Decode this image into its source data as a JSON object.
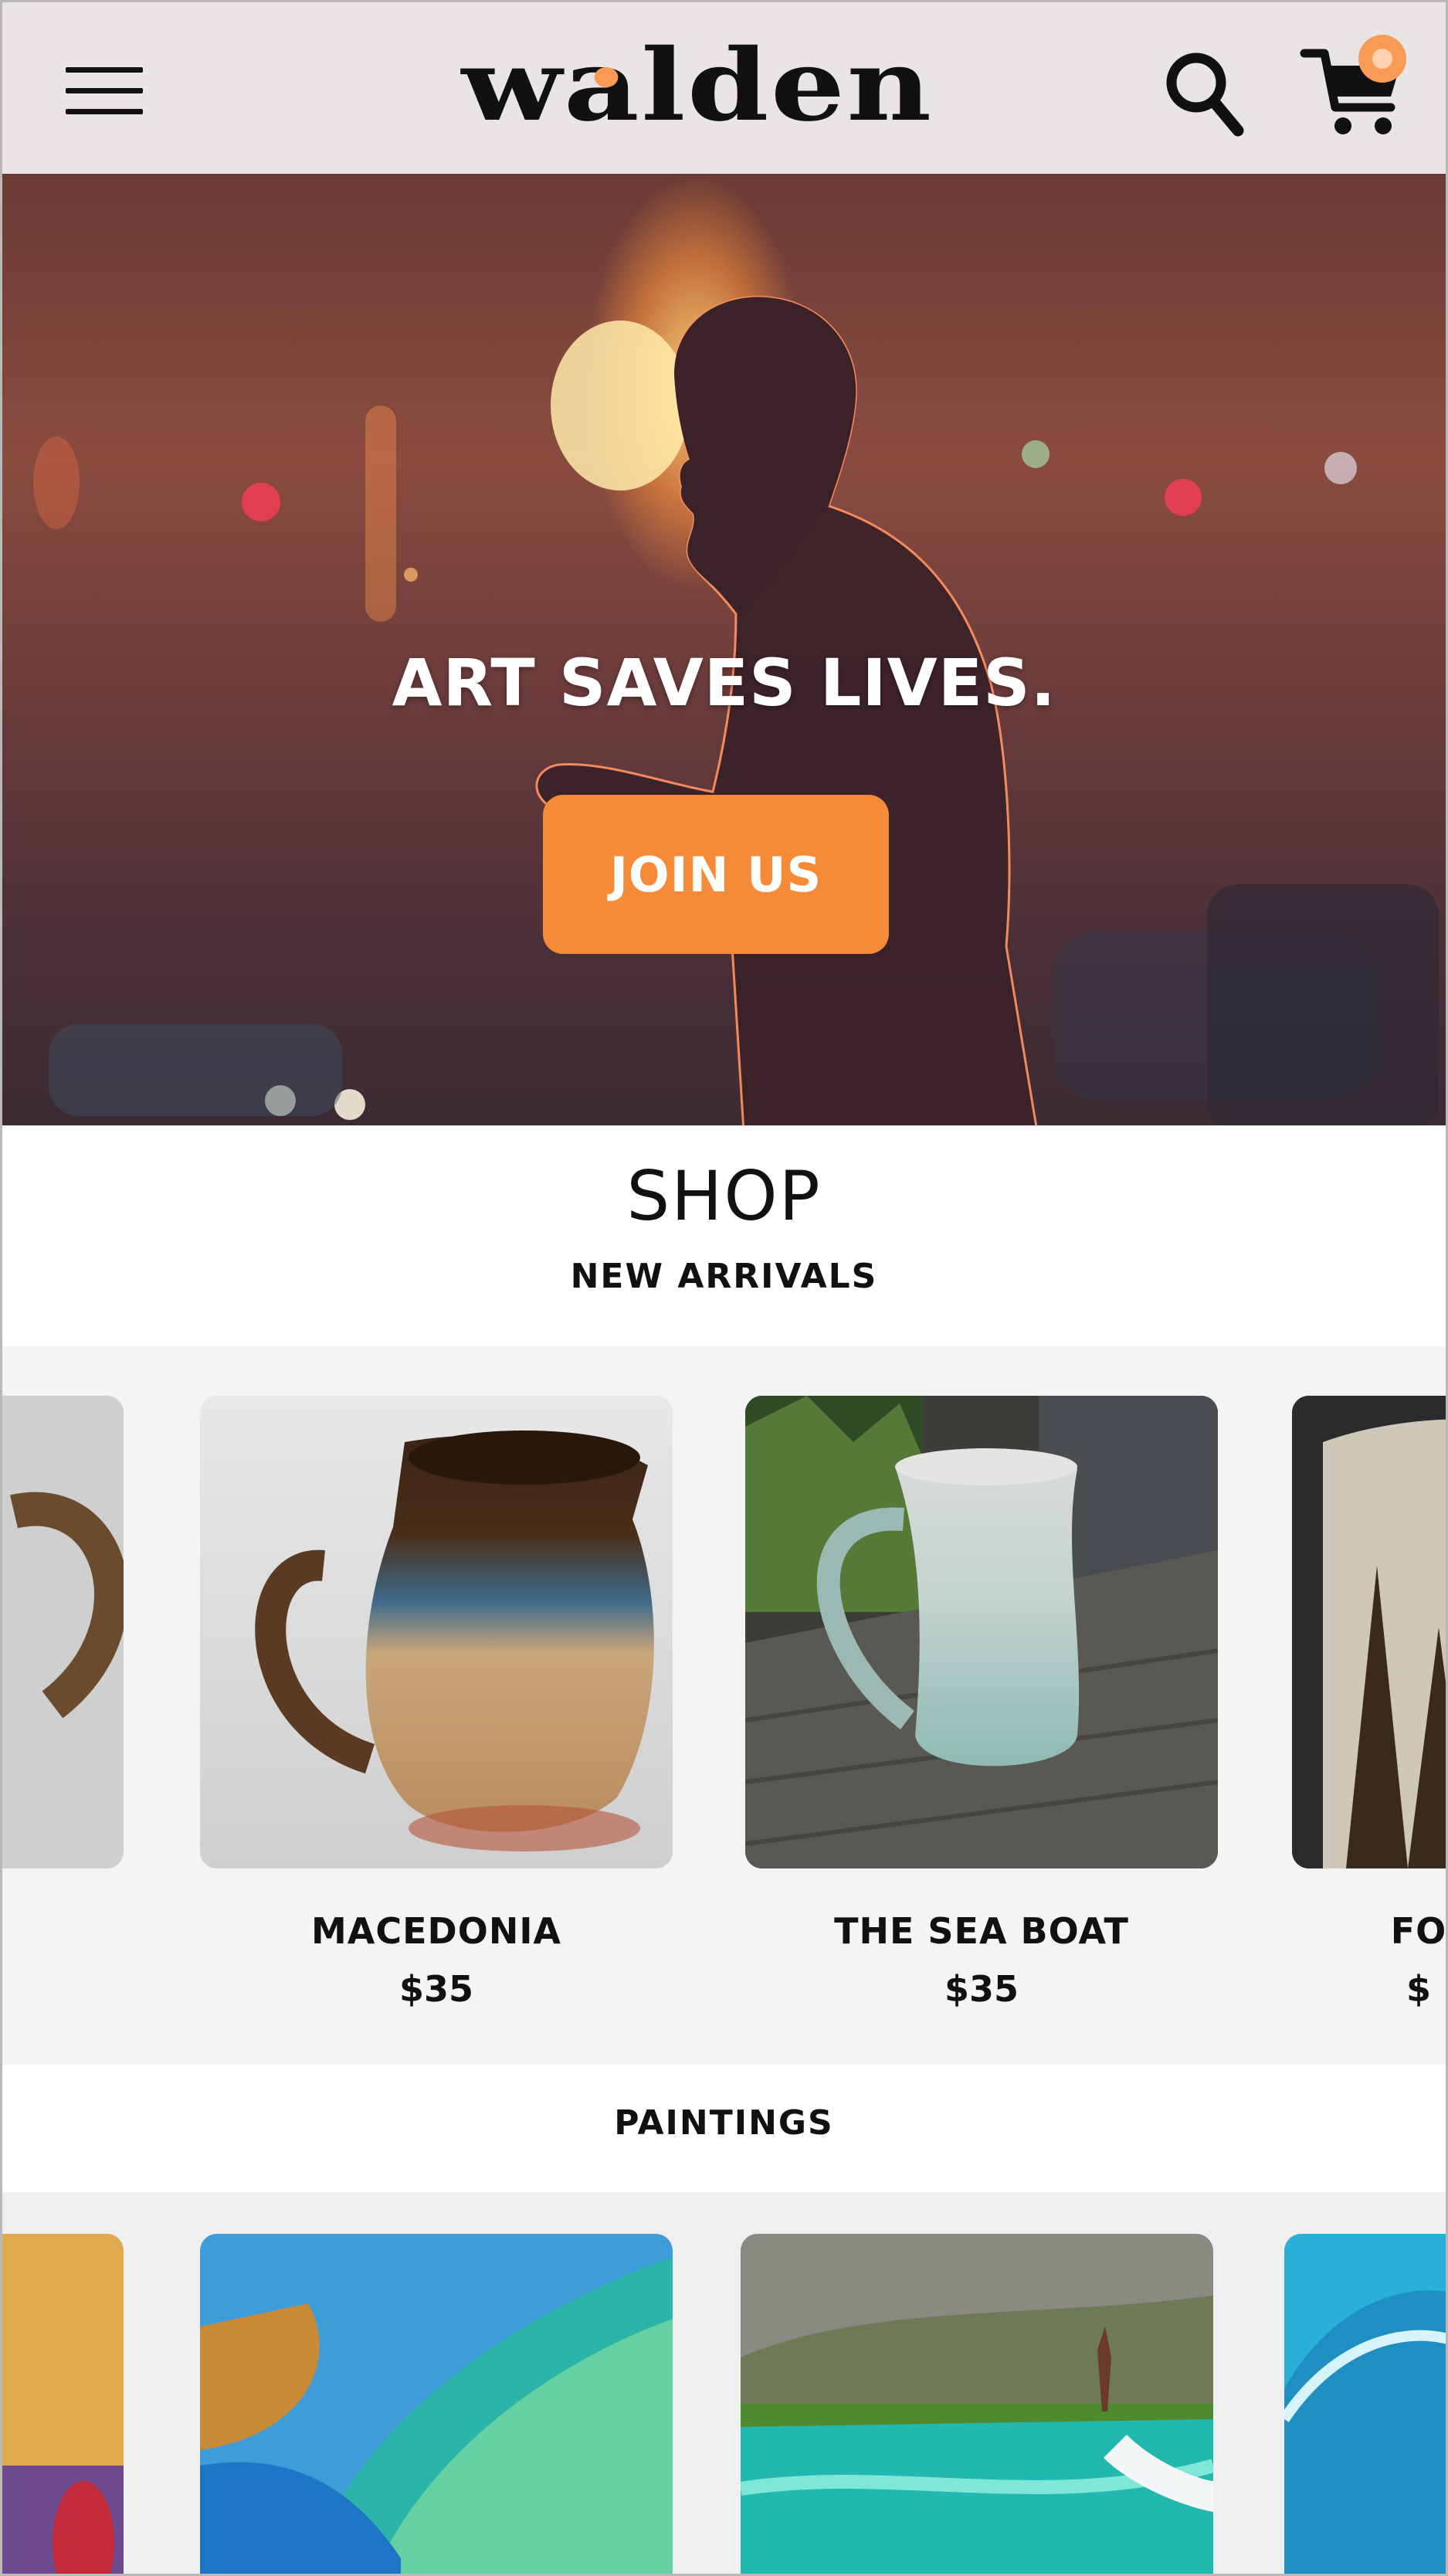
{
  "header": {
    "logo_text": "walden",
    "menu_icon": "hamburger-menu-icon",
    "search_icon": "search-icon",
    "cart_icon": "shopping-cart-icon",
    "cart_badge_color": "#f99a57"
  },
  "hero": {
    "title": "ART SAVES LIVES.",
    "cta_label": "JOIN US",
    "cta_color": "#f58a38"
  },
  "shop": {
    "title": "SHOP",
    "new_arrivals": {
      "heading": "NEW ARRIVALS",
      "products": [
        {
          "name": "MACEDONIA",
          "price": "$35"
        },
        {
          "name": "THE SEA BOAT",
          "price": "$35"
        },
        {
          "name": "FO",
          "price": "$"
        }
      ]
    },
    "paintings": {
      "heading": "PAINTINGS"
    }
  }
}
